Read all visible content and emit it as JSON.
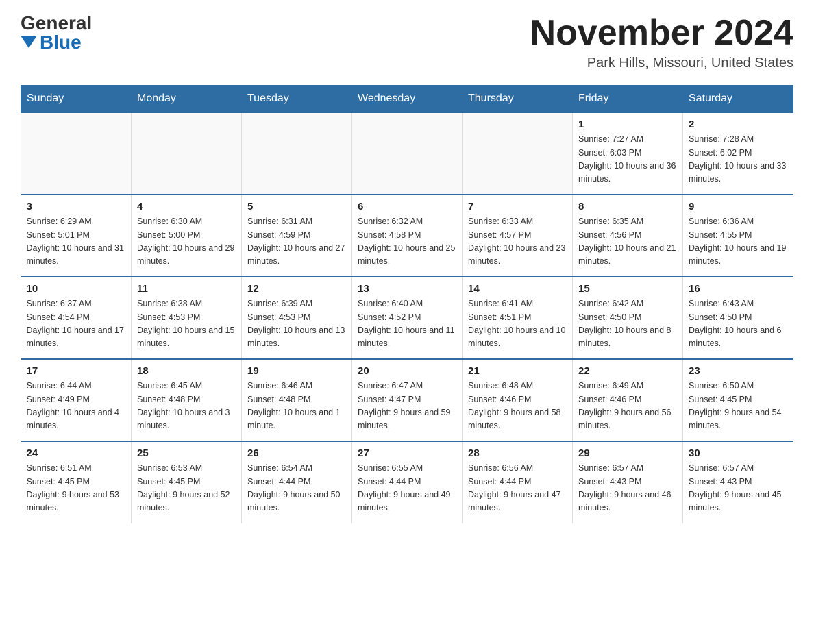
{
  "header": {
    "logo_general": "General",
    "logo_blue": "Blue",
    "month_title": "November 2024",
    "location": "Park Hills, Missouri, United States"
  },
  "days_of_week": [
    "Sunday",
    "Monday",
    "Tuesday",
    "Wednesday",
    "Thursday",
    "Friday",
    "Saturday"
  ],
  "weeks": [
    [
      {
        "day": "",
        "info": ""
      },
      {
        "day": "",
        "info": ""
      },
      {
        "day": "",
        "info": ""
      },
      {
        "day": "",
        "info": ""
      },
      {
        "day": "",
        "info": ""
      },
      {
        "day": "1",
        "info": "Sunrise: 7:27 AM\nSunset: 6:03 PM\nDaylight: 10 hours and 36 minutes."
      },
      {
        "day": "2",
        "info": "Sunrise: 7:28 AM\nSunset: 6:02 PM\nDaylight: 10 hours and 33 minutes."
      }
    ],
    [
      {
        "day": "3",
        "info": "Sunrise: 6:29 AM\nSunset: 5:01 PM\nDaylight: 10 hours and 31 minutes."
      },
      {
        "day": "4",
        "info": "Sunrise: 6:30 AM\nSunset: 5:00 PM\nDaylight: 10 hours and 29 minutes."
      },
      {
        "day": "5",
        "info": "Sunrise: 6:31 AM\nSunset: 4:59 PM\nDaylight: 10 hours and 27 minutes."
      },
      {
        "day": "6",
        "info": "Sunrise: 6:32 AM\nSunset: 4:58 PM\nDaylight: 10 hours and 25 minutes."
      },
      {
        "day": "7",
        "info": "Sunrise: 6:33 AM\nSunset: 4:57 PM\nDaylight: 10 hours and 23 minutes."
      },
      {
        "day": "8",
        "info": "Sunrise: 6:35 AM\nSunset: 4:56 PM\nDaylight: 10 hours and 21 minutes."
      },
      {
        "day": "9",
        "info": "Sunrise: 6:36 AM\nSunset: 4:55 PM\nDaylight: 10 hours and 19 minutes."
      }
    ],
    [
      {
        "day": "10",
        "info": "Sunrise: 6:37 AM\nSunset: 4:54 PM\nDaylight: 10 hours and 17 minutes."
      },
      {
        "day": "11",
        "info": "Sunrise: 6:38 AM\nSunset: 4:53 PM\nDaylight: 10 hours and 15 minutes."
      },
      {
        "day": "12",
        "info": "Sunrise: 6:39 AM\nSunset: 4:53 PM\nDaylight: 10 hours and 13 minutes."
      },
      {
        "day": "13",
        "info": "Sunrise: 6:40 AM\nSunset: 4:52 PM\nDaylight: 10 hours and 11 minutes."
      },
      {
        "day": "14",
        "info": "Sunrise: 6:41 AM\nSunset: 4:51 PM\nDaylight: 10 hours and 10 minutes."
      },
      {
        "day": "15",
        "info": "Sunrise: 6:42 AM\nSunset: 4:50 PM\nDaylight: 10 hours and 8 minutes."
      },
      {
        "day": "16",
        "info": "Sunrise: 6:43 AM\nSunset: 4:50 PM\nDaylight: 10 hours and 6 minutes."
      }
    ],
    [
      {
        "day": "17",
        "info": "Sunrise: 6:44 AM\nSunset: 4:49 PM\nDaylight: 10 hours and 4 minutes."
      },
      {
        "day": "18",
        "info": "Sunrise: 6:45 AM\nSunset: 4:48 PM\nDaylight: 10 hours and 3 minutes."
      },
      {
        "day": "19",
        "info": "Sunrise: 6:46 AM\nSunset: 4:48 PM\nDaylight: 10 hours and 1 minute."
      },
      {
        "day": "20",
        "info": "Sunrise: 6:47 AM\nSunset: 4:47 PM\nDaylight: 9 hours and 59 minutes."
      },
      {
        "day": "21",
        "info": "Sunrise: 6:48 AM\nSunset: 4:46 PM\nDaylight: 9 hours and 58 minutes."
      },
      {
        "day": "22",
        "info": "Sunrise: 6:49 AM\nSunset: 4:46 PM\nDaylight: 9 hours and 56 minutes."
      },
      {
        "day": "23",
        "info": "Sunrise: 6:50 AM\nSunset: 4:45 PM\nDaylight: 9 hours and 54 minutes."
      }
    ],
    [
      {
        "day": "24",
        "info": "Sunrise: 6:51 AM\nSunset: 4:45 PM\nDaylight: 9 hours and 53 minutes."
      },
      {
        "day": "25",
        "info": "Sunrise: 6:53 AM\nSunset: 4:45 PM\nDaylight: 9 hours and 52 minutes."
      },
      {
        "day": "26",
        "info": "Sunrise: 6:54 AM\nSunset: 4:44 PM\nDaylight: 9 hours and 50 minutes."
      },
      {
        "day": "27",
        "info": "Sunrise: 6:55 AM\nSunset: 4:44 PM\nDaylight: 9 hours and 49 minutes."
      },
      {
        "day": "28",
        "info": "Sunrise: 6:56 AM\nSunset: 4:44 PM\nDaylight: 9 hours and 47 minutes."
      },
      {
        "day": "29",
        "info": "Sunrise: 6:57 AM\nSunset: 4:43 PM\nDaylight: 9 hours and 46 minutes."
      },
      {
        "day": "30",
        "info": "Sunrise: 6:57 AM\nSunset: 4:43 PM\nDaylight: 9 hours and 45 minutes."
      }
    ]
  ]
}
